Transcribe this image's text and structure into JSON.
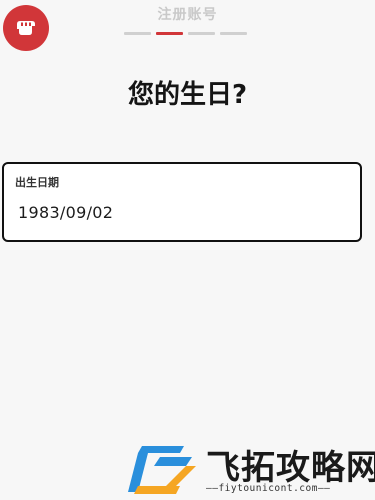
{
  "header": {
    "title": "注册账号",
    "steps_total": 4,
    "active_step": 2
  },
  "question": "您的生日?",
  "birthday_field": {
    "label": "出生日期",
    "value": "1983/09/02"
  },
  "watermark": {
    "site_name": "飞拓攻略网",
    "url": "——fiytounicont.com——"
  },
  "colors": {
    "brand_red": "#d13639",
    "background": "#f7f7f7"
  },
  "icons": {
    "logo": "fist-logo-icon",
    "watermark": "fz-watermark-logo-icon"
  }
}
